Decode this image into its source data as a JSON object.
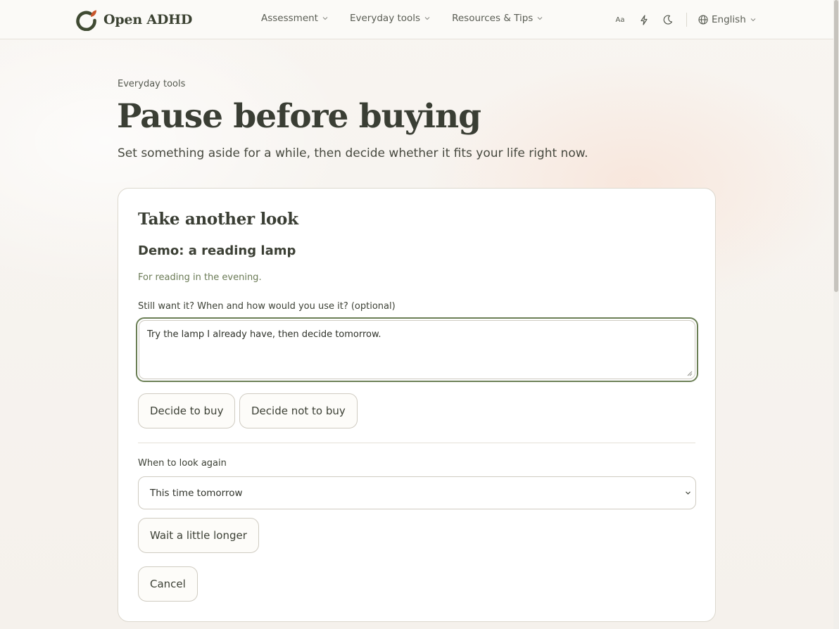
{
  "brand": {
    "name": "Open ADHD",
    "accent": "#3b4a2e"
  },
  "nav": {
    "items": [
      {
        "label": "Assessment"
      },
      {
        "label": "Everyday tools"
      },
      {
        "label": "Resources & Tips"
      }
    ]
  },
  "toolbar": {
    "text_size_label": "Aa",
    "icons": [
      "text-size-icon",
      "lightning-icon",
      "moon-icon"
    ],
    "language": "English"
  },
  "page": {
    "breadcrumb": "Everyday tools",
    "title": "Pause before buying",
    "subtitle": "Set something aside for a while, then decide whether it fits your life right now."
  },
  "card": {
    "title": "Take another look",
    "item_title": "Demo: a reading lamp",
    "item_note": "For reading in the evening.",
    "reflection_label": "Still want it? When and how would you use it? (optional)",
    "reflection_value": "Try the lamp I already have, then decide tomorrow.",
    "decide_buy_label": "Decide to buy",
    "decide_not_buy_label": "Decide not to buy",
    "look_again_label": "When to look again",
    "look_again_selected": "This time tomorrow",
    "wait_label": "Wait a little longer",
    "cancel_label": "Cancel"
  }
}
